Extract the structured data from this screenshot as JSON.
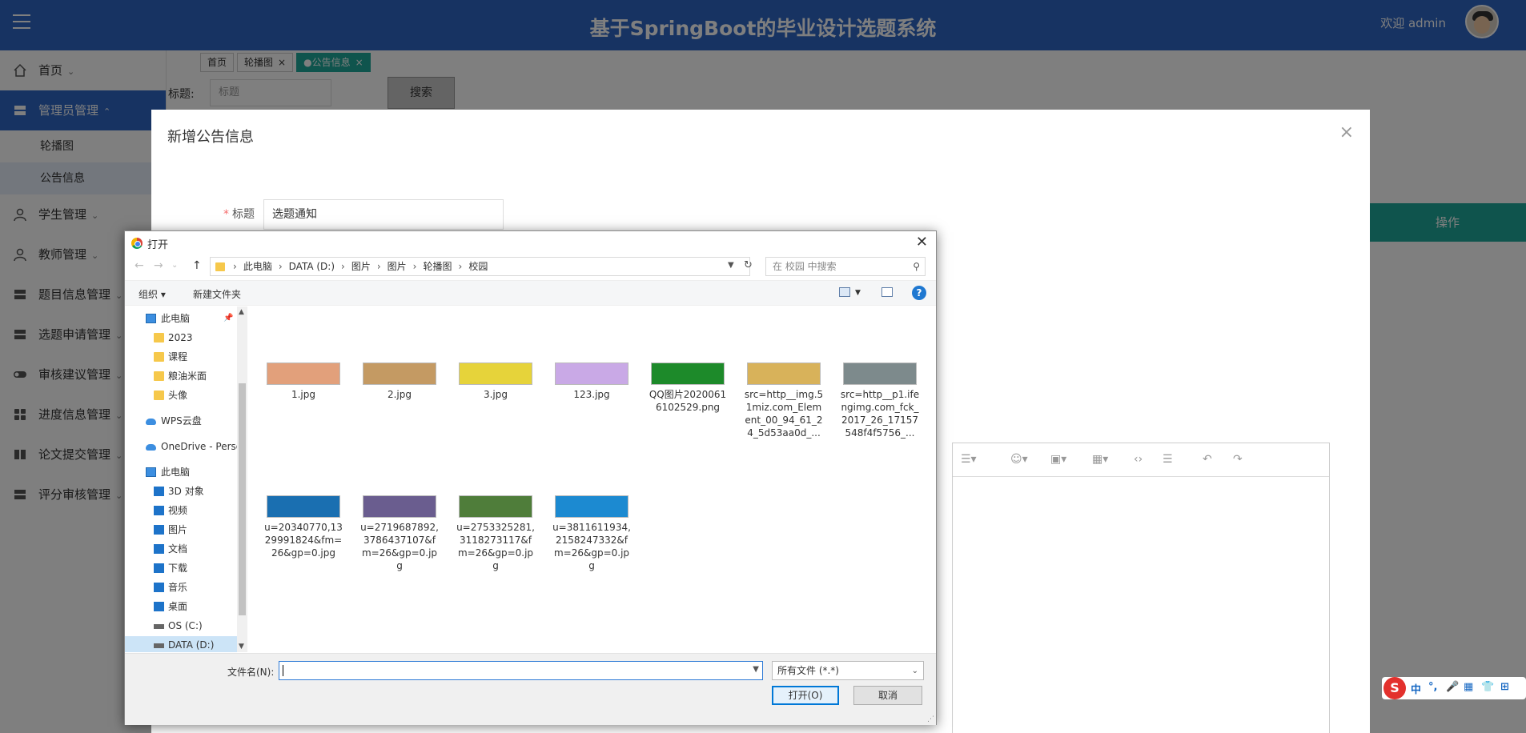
{
  "header": {
    "title": "基于SpringBoot的毕业设计选题系统",
    "welcome": "欢迎 admin"
  },
  "sidebar": {
    "items": [
      {
        "label": "首页",
        "chevron": "⌄"
      },
      {
        "label": "管理员管理",
        "chevron": "⌃",
        "sub": [
          "轮播图",
          "公告信息"
        ]
      },
      {
        "label": "学生管理",
        "chevron": "⌄"
      },
      {
        "label": "教师管理",
        "chevron": "⌄"
      },
      {
        "label": "题目信息管理",
        "chevron": "⌄"
      },
      {
        "label": "选题申请管理",
        "chevron": "⌄"
      },
      {
        "label": "审核建议管理",
        "chevron": "⌄"
      },
      {
        "label": "进度信息管理",
        "chevron": "⌄"
      },
      {
        "label": "论文提交管理",
        "chevron": "⌄"
      },
      {
        "label": "评分审核管理",
        "chevron": "⌄"
      }
    ]
  },
  "tabs": [
    {
      "label": "首页"
    },
    {
      "label": "轮播图",
      "close": "×"
    },
    {
      "label": "●公告信息",
      "close": "×"
    }
  ],
  "search": {
    "label": "标题:",
    "placeholder": "标题",
    "button": "搜索"
  },
  "table": {
    "op_header": "操作"
  },
  "modal": {
    "title": "新增公告信息",
    "close": "×",
    "field_required": "*",
    "field_label": "标题",
    "field_value": "选题通知"
  },
  "dialog": {
    "title": "打开",
    "close": "✕",
    "nav": {
      "back": "←",
      "forward": "→",
      "recent": "⌄",
      "up": "↑"
    },
    "breadcrumb": [
      "此电脑",
      "DATA (D:)",
      "图片",
      "图片",
      "轮播图",
      "校园"
    ],
    "crumb_sep": "›",
    "search_placeholder": "在 校园 中搜索",
    "toolbar": {
      "organize": "组织 ▾",
      "new_folder": "新建文件夹",
      "help": "?"
    },
    "tree": [
      {
        "label": "此电脑",
        "icon": "pc",
        "pin": "📌"
      },
      {
        "label": "2023",
        "icon": "folder"
      },
      {
        "label": "课程",
        "icon": "folder"
      },
      {
        "label": "粮油米面",
        "icon": "folder"
      },
      {
        "label": "头像",
        "icon": "folder"
      },
      {
        "label": "WPS云盘",
        "icon": "cloud"
      },
      {
        "label": "OneDrive - Perso",
        "icon": "cloud"
      },
      {
        "label": "此电脑",
        "icon": "pc"
      },
      {
        "label": "3D 对象",
        "icon": "blue"
      },
      {
        "label": "视频",
        "icon": "blue"
      },
      {
        "label": "图片",
        "icon": "blue"
      },
      {
        "label": "文档",
        "icon": "blue"
      },
      {
        "label": "下载",
        "icon": "blue"
      },
      {
        "label": "音乐",
        "icon": "blue"
      },
      {
        "label": "桌面",
        "icon": "blue"
      },
      {
        "label": "OS (C:)",
        "icon": "drive"
      },
      {
        "label": "DATA (D:)",
        "icon": "drive"
      }
    ],
    "files": [
      {
        "name": "1.jpg",
        "color": "#e2a07b"
      },
      {
        "name": "2.jpg",
        "color": "#c49a63"
      },
      {
        "name": "3.jpg",
        "color": "#e6d33a"
      },
      {
        "name": "123.jpg",
        "color": "#c9a9e6"
      },
      {
        "name": "QQ图片20200616102529.png",
        "color": "#1d8a2a"
      },
      {
        "name": "src=http__img.51miz.com_Element_00_94_61_24_5d53aa0d_...",
        "color": "#d8b25a"
      },
      {
        "name": "src=http__p1.ifengimg.com_fck_2017_26_17157548f4f5756_...",
        "color": "#7d8a8c"
      },
      {
        "name": "u=20340770,1329991824&fm=26&gp=0.jpg",
        "color": "#1a6fb1"
      },
      {
        "name": "u=2719687892,3786437107&fm=26&gp=0.jpg",
        "color": "#6a5d8f"
      },
      {
        "name": "u=2753325281,3118273117&fm=26&gp=0.jpg",
        "color": "#4f7d3a"
      },
      {
        "name": "u=3811611934,2158247332&fm=26&gp=0.jpg",
        "color": "#1c8ad1"
      }
    ],
    "filename_label": "文件名(N):",
    "filename_value": "",
    "filter": "所有文件 (*.*)",
    "open_button": "打开(O)",
    "cancel_button": "取消"
  },
  "ime": {
    "logo": "S",
    "items": [
      "中",
      "°,",
      "🎤",
      "▦",
      "👕",
      "⊞"
    ]
  },
  "colors": {
    "header": "#2f66c4",
    "active_tab": "#1fa89a",
    "dialog_accent": "#0078d7"
  }
}
